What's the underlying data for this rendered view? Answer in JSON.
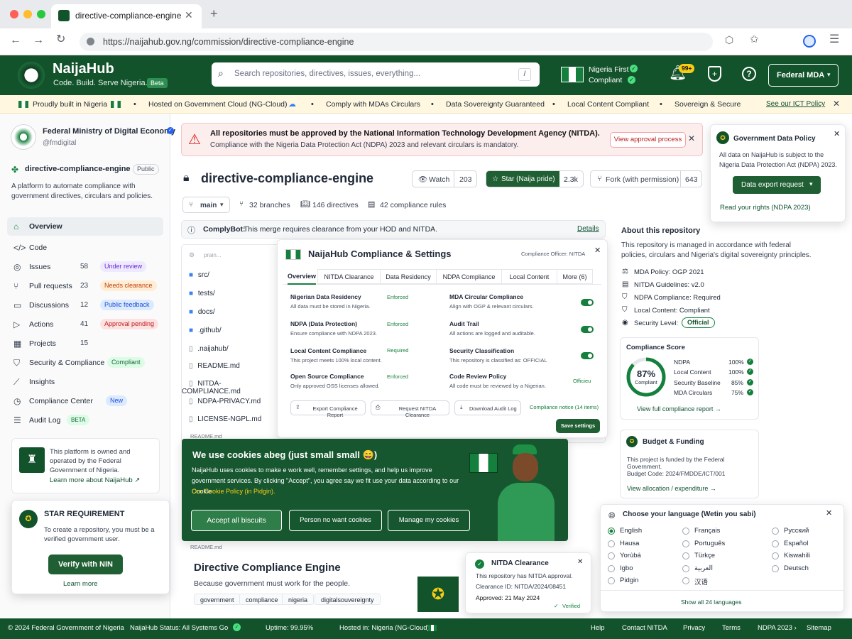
{
  "browser": {
    "tab_title": "directive-compliance-engine",
    "url": "https://naijahub.gov.ng/commission/directive-compliance-engine"
  },
  "header": {
    "brand": "NaijaHub",
    "tagline": "Code. Build. Serve Nigeria.",
    "beta": "Beta",
    "search_placeholder": "Search repositories, directives, issues, everything...",
    "search_shortcut": "/",
    "nf_line1": "Nigeria First",
    "nf_line2": "Compliant",
    "notif_count": "99+",
    "account": "Federal MDA"
  },
  "banner": {
    "items": [
      "Proudly built in Nigeria",
      "Hosted on Government Cloud (NG-Cloud)",
      "Comply with MDAs Circulars",
      "Data Sovereignty Guaranteed",
      "Local Content Compliant",
      "Sovereign & Secure"
    ],
    "link": "See our ICT Policy",
    "sep": "•"
  },
  "org": {
    "name": "Federal Ministry of Digital Economy",
    "handle": "@fmdigital"
  },
  "repo": {
    "name": "directive-compliance-engine",
    "visibility": "Public",
    "description": "A platform to automate compliance with government directives, circulars and policies."
  },
  "nav": [
    {
      "label": "Overview",
      "count": "",
      "badge": ""
    },
    {
      "label": "Code",
      "count": "",
      "badge": ""
    },
    {
      "label": "Issues",
      "count": "58",
      "badge": "Under review"
    },
    {
      "label": "Pull requests",
      "count": "23",
      "badge": "Needs clearance"
    },
    {
      "label": "Discussions",
      "count": "12",
      "badge": "Public feedback"
    },
    {
      "label": "Actions",
      "count": "41",
      "badge": "Approval pending"
    },
    {
      "label": "Projects",
      "count": "15",
      "badge": ""
    },
    {
      "label": "Security & Compliance",
      "count": "",
      "badge": "Compliant"
    },
    {
      "label": "Insights",
      "count": "",
      "badge": ""
    },
    {
      "label": "Compliance Center",
      "count": "",
      "badge": "New"
    },
    {
      "label": "Audit Log",
      "count": "",
      "badge": "BETA"
    }
  ],
  "owned": {
    "text": "This platform is owned and operated by the Federal Government of Nigeria.",
    "link": "Learn more about NaijaHub ↗"
  },
  "star_req": {
    "title": "STAR REQUIREMENT",
    "text": "To create a repository, you must be a verified government user.",
    "button": "Verify with NIN",
    "link": "Learn more"
  },
  "alert": {
    "title": "All repositories must be approved by the National Information Technology Development Agency (NITDA).",
    "text": "Compliance with the Nigeria Data Protection Act (NDPA) 2023 and relevant circulars is mandatory.",
    "button": "View approval process"
  },
  "actions": {
    "watch": "Watch",
    "watch_count": "203",
    "star": "Star (Naija pride)",
    "star_count": "2.3k",
    "fork": "Fork (with permission)",
    "fork_count": "643"
  },
  "branchbar": {
    "branch": "main",
    "branches": "32 branches",
    "directives": "146 directives",
    "rules": "42 compliance rules"
  },
  "complybot": {
    "name": "ComplyBot:",
    "text": "This merge requires clearance from your HOD and NITDA.",
    "link": "Details"
  },
  "files": {
    "header": "prain...",
    "items": [
      "src/",
      "tests/",
      "docs/",
      ".github/",
      ".naijahub/",
      "README.md",
      "NITDA-COMPLIANCE.md",
      "NDPA-PRIVACY.md",
      "LICENSE-NGPL.md"
    ],
    "readme_label": "README.md"
  },
  "readme": {
    "title": "Directive Compliance Engine",
    "subtitle": "Because government must work for the people.",
    "tags": [
      "government",
      "compliance",
      "nigeria",
      "digitalsouvereignty"
    ]
  },
  "modal": {
    "title": "NaijaHub Compliance & Settings",
    "officer": "Compliance Officer: NITDA",
    "tabs": [
      "Overview",
      "NITDA Clearance",
      "Data Residency",
      "NDPA Compliance",
      "Local Content",
      "More (6)"
    ],
    "left": [
      {
        "title": "Nigerian Data Residency",
        "desc": "All data must be stored in Nigeria.",
        "status": "Enforced"
      },
      {
        "title": "NDPA (Data Protection)",
        "desc": "Ensure compliance with NDPA 2023.",
        "status": "Enforced"
      },
      {
        "title": "Local Content Compliance",
        "desc": "This project meets 100% local content.",
        "status": "Required"
      },
      {
        "title": "Open Source Compliance",
        "desc": "Only approved OSS licenses allowed.",
        "status": "Enforced"
      }
    ],
    "right": [
      {
        "title": "MDA Circular Compliance",
        "desc": "Align with OGP & relevant circulars."
      },
      {
        "title": "Audit Trail",
        "desc": "All actions are logged and auditable."
      },
      {
        "title": "Security Classification",
        "desc": "This repository is classified as: OFFICIAL"
      },
      {
        "title": "Code Review Policy",
        "desc": "All code must be reviewed by a Nigerian.",
        "status": "Officieu"
      }
    ],
    "btn1": "Export Compliance Report",
    "btn2": "Request NITDA Clearance",
    "btn3": "Download Audit Log",
    "notice": "Compliance notice (14 items)",
    "save": "Save settings"
  },
  "cookie": {
    "title": "We use cookies abeg (just small small 😄)",
    "text": "NaijaHub uses cookies to make e work well, remember settings, and help us improve government services. By clicking \"Accept\", you agree say we fit use your data according to our Cookie",
    "policy": "Our Cookie Policy (in Pidgin).",
    "accept": "Accept all biscuits",
    "reject": "Person no want cookies",
    "manage": "Manage my cookies"
  },
  "nitda": {
    "title": "NITDA Clearance",
    "l1": "This repository has NITDA approval.",
    "l2": "Clearance ID: NITDA/2024/08451",
    "l3": "Approved: 21 May 2024",
    "verified": "Verified"
  },
  "policy": {
    "title": "Government Data Policy",
    "text": "All data on NaijaHub is subject to the Nigeria Data Protection Act (NDPA) 2023.",
    "button": "Data export request",
    "link": "Read your rights (NDPA 2023)"
  },
  "about": {
    "title": "About this repository",
    "text": "This repository is managed in accordance with federal policies, circulars and Nigeria's digital sovereignty principles.",
    "items": [
      "MDA Policy: OGP 2021",
      "NITDA Guidelines: v2.0",
      "NDPA Compliance: Required",
      "Local Content: Compliant",
      "Security Level:"
    ],
    "level": "Official"
  },
  "score": {
    "title": "Compliance Score",
    "pct": "87%",
    "label": "Compliant",
    "value": 0.87,
    "rows": [
      {
        "k": "NDPA",
        "v": "100%"
      },
      {
        "k": "Local Content",
        "v": "100%"
      },
      {
        "k": "Security Baseline",
        "v": "85%"
      },
      {
        "k": "MDA Circulars",
        "v": "75%"
      }
    ],
    "link": "View full compliance report →"
  },
  "budget": {
    "title": "Budget & Funding",
    "text": "This project is funded by the Federal Government.",
    "code": "Budget Code: 2024/FMDDE/ICT/001",
    "link": "View allocation / expenditure →"
  },
  "lang": {
    "title": "Choose your language (Wetin you sabi)",
    "col1": [
      "English",
      "Hausa",
      "Yorùbá",
      "Igbo",
      "Pidgin"
    ],
    "col2": [
      "Français",
      "Português",
      "Türkçe",
      "العربية",
      "汉语"
    ],
    "col3": [
      "Русский",
      "Español",
      "Kiswahili",
      "Deutsch"
    ],
    "link": "Show all 24 languages"
  },
  "footer": {
    "copy": "© 2024 Federal Government of Nigeria",
    "status": "NaijaHub Status: All Systems Go",
    "uptime_label": "Uptime:",
    "uptime": "99.95%",
    "hosted": "Hosted in: Nigeria (NG-Cloud)",
    "links": [
      "Help",
      "Contact NITDA",
      "Privacy",
      "Terms",
      "NDPA 2023 ›",
      "Sitemap"
    ]
  },
  "colors": {
    "brand": "#13532b",
    "accent": "#15803d",
    "alert_bg": "#fdeeee"
  }
}
